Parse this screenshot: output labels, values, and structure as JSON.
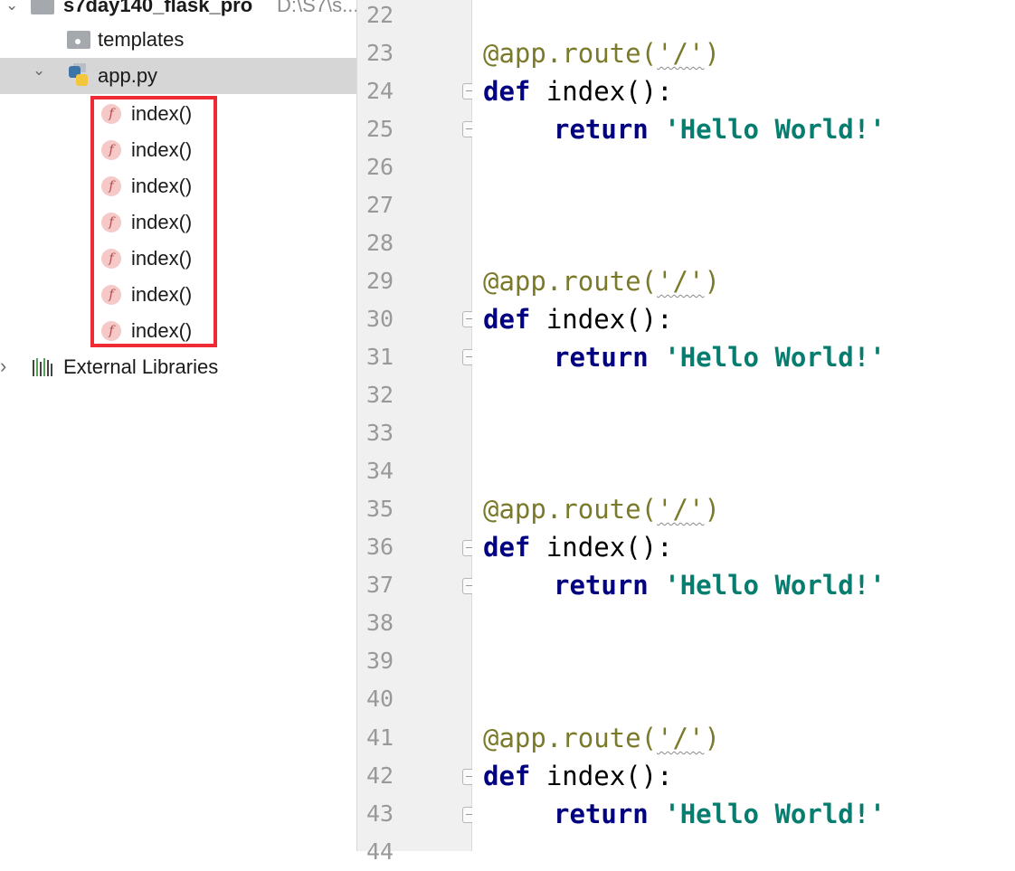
{
  "project": {
    "root_name": "s7day140_flask_pro",
    "root_path": "D:\\S7\\s..."
  },
  "tree": {
    "templates": "templates",
    "app_file": "app.py",
    "functions": [
      "index()",
      "index()",
      "index()",
      "index()",
      "index()",
      "index()",
      "index()"
    ],
    "external_libraries": "External Libraries"
  },
  "editor": {
    "line_numbers": [
      "22",
      "23",
      "24",
      "25",
      "26",
      "27",
      "28",
      "29",
      "30",
      "31",
      "32",
      "33",
      "34",
      "35",
      "36",
      "37",
      "38",
      "39",
      "40",
      "41",
      "42",
      "43",
      "44"
    ],
    "decorator_at": "@app.route(",
    "decorator_arg": "'/'",
    "decorator_close": ")",
    "def_kw": "def",
    "def_rest": " index():",
    "return_kw": "return",
    "return_str": "'Hello World!'",
    "current_line": "43"
  },
  "colors": {
    "highlight_box": "#ee2b35",
    "keyword": "#000080",
    "string": "#067d6e",
    "decorator": "#7a7a2a"
  }
}
